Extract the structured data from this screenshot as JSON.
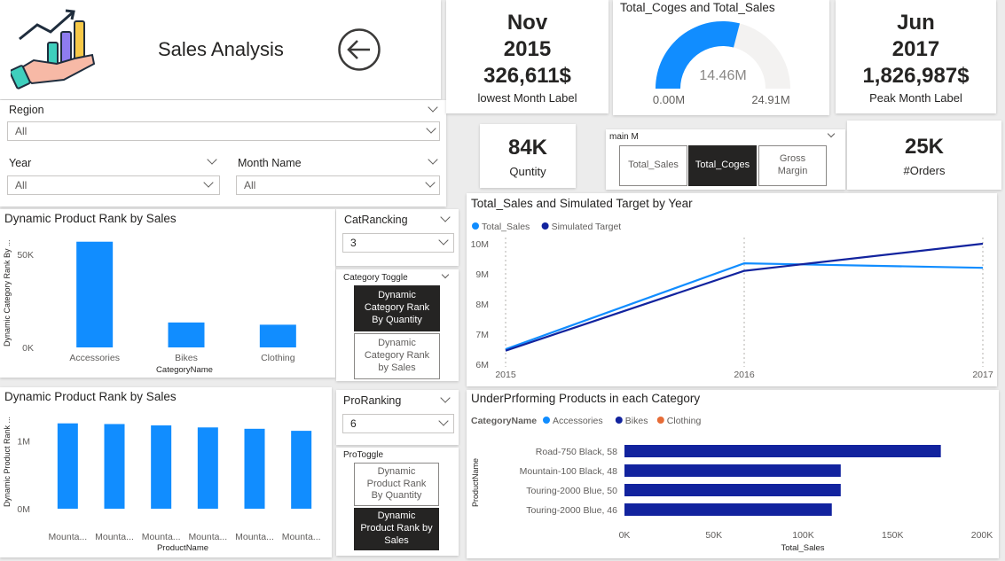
{
  "header": {
    "title": "Sales Analysis"
  },
  "icons": {
    "logo": "hand-holding-chart-icon",
    "back": "back-arrow-icon"
  },
  "colors": {
    "accent": "#118DFF",
    "dark_blue": "#12239E",
    "orange": "#E66C37",
    "selected_button": "#252423",
    "gauge_track": "#F3F2F1"
  },
  "slicers": {
    "region": {
      "label": "Region",
      "value": "All"
    },
    "year": {
      "label": "Year",
      "value": "All"
    },
    "month": {
      "label": "Month Name",
      "value": "All"
    },
    "catranking": {
      "label": "CatRancking",
      "value": "3"
    },
    "proranking": {
      "label": "ProRanking",
      "value": "6"
    }
  },
  "category_toggle": {
    "label": "Category Toggle",
    "btn1": "Dynamic Category Rank By Quantity",
    "btn2": "Dynamic Category Rank by Sales"
  },
  "pro_toggle": {
    "label": "ProToggle",
    "btn1": "Dynamic Product Rank By Quantity",
    "btn2": "Dynamic Product Rank by Sales"
  },
  "main_m": {
    "label": "main M",
    "btn1": "Total_Sales",
    "btn2": "Total_Coges",
    "btn3": "Gross Margin"
  },
  "kpi_lowest": {
    "month": "Nov",
    "year": "2015",
    "value": "326,611$",
    "label": "lowest Month Label"
  },
  "kpi_peak": {
    "month": "Jun",
    "year": "2017",
    "value": "1,826,987$",
    "label": "Peak Month Label"
  },
  "kpi_quantity": {
    "value": "84K",
    "label": "Quntity"
  },
  "kpi_orders": {
    "value": "25K",
    "label": "#Orders"
  },
  "gauge": {
    "title": "Total_Coges and Total_Sales",
    "value_label": "14.46M",
    "min_label": "0.00M",
    "max_label": "24.91M"
  },
  "cat_chart": {
    "title": "Dynamic Product Rank by Sales"
  },
  "prod_chart": {
    "title": "Dynamic Product Rank by Sales"
  },
  "line_chart": {
    "title": "Total_Sales and Simulated Target by Year"
  },
  "under_chart": {
    "title": "UnderPrforming Products in each Category"
  },
  "chart_data": [
    {
      "type": "bar",
      "title": "Dynamic Product Rank by Sales",
      "xlabel": "CategoryName",
      "ylabel": "Dynamic Category Rank By ...",
      "categories": [
        "Accessories",
        "Bikes",
        "Clothing"
      ],
      "values": [
        56800,
        13400,
        12200
      ],
      "ylim": [
        0,
        60000
      ],
      "yticks": [
        "0K",
        "50K"
      ],
      "color": "#118DFF"
    },
    {
      "type": "bar",
      "title": "Dynamic Product Rank by Sales",
      "xlabel": "ProductName",
      "ylabel": "Dynamic Product Rank ...",
      "categories": [
        "Mounta...",
        "Mounta...",
        "Mounta...",
        "Mounta...",
        "Mounta...",
        "Mounta..."
      ],
      "values": [
        1260000,
        1250000,
        1230000,
        1200000,
        1180000,
        1150000
      ],
      "ylim": [
        0,
        1400000
      ],
      "yticks": [
        "0M",
        "1M"
      ],
      "color": "#118DFF"
    },
    {
      "type": "line",
      "title": "Total_Sales and Simulated Target by Year",
      "x": [
        "2015",
        "2016",
        "2017"
      ],
      "yticks": [
        "6M",
        "7M",
        "8M",
        "9M",
        "10M"
      ],
      "ylim": [
        6000000,
        10000000
      ],
      "series": [
        {
          "name": "Total_Sales",
          "values": [
            6500000,
            9350000,
            9200000
          ],
          "color": "#118DFF"
        },
        {
          "name": "Simulated Target",
          "values": [
            6450000,
            9100000,
            10000000
          ],
          "color": "#12239E"
        }
      ]
    },
    {
      "type": "bar",
      "orientation": "horizontal",
      "title": "UnderPrforming Products in each Category",
      "legend_title": "CategoryName",
      "legend": [
        {
          "name": "Accessories",
          "color": "#118DFF"
        },
        {
          "name": "Bikes",
          "color": "#12239E"
        },
        {
          "name": "Clothing",
          "color": "#E66C37"
        }
      ],
      "xlabel": "Total_Sales",
      "ylabel": "ProductName",
      "categories": [
        "Road-750 Black, 58",
        "Mountain-100 Black, 48",
        "Touring-2000 Blue, 50",
        "Touring-2000 Blue, 46"
      ],
      "values": [
        177000,
        121000,
        121000,
        116000
      ],
      "xlim": [
        0,
        200000
      ],
      "xticks": [
        "0K",
        "50K",
        "100K",
        "150K",
        "200K"
      ],
      "color": "#12239E"
    }
  ]
}
